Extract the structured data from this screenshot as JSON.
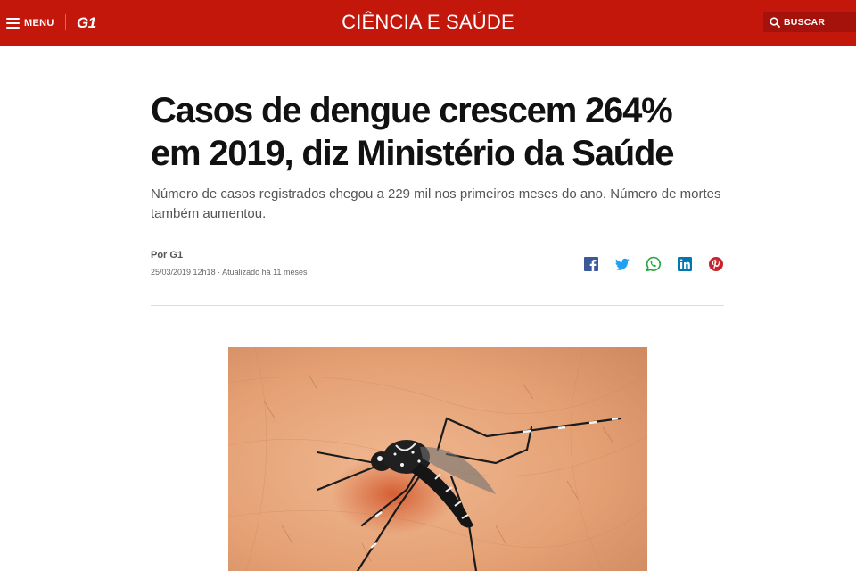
{
  "header": {
    "menu_label": "MENU",
    "logo_text": "G1",
    "section_title": "CIÊNCIA E SAÚDE",
    "search_label": "BUSCAR",
    "colors": {
      "brand_red": "#c4170c",
      "search_bg": "#a4120b"
    }
  },
  "article": {
    "title": "Casos de dengue crescem 264% em 2019, diz Ministério da Saúde",
    "subtitle": "Número de casos registrados chegou a 229 mil nos primeiros meses do ano. Número de mortes também aumentou.",
    "byline": "Por G1",
    "date": "25/03/2019 12h18 · Atualizado há 11 meses"
  },
  "share": {
    "icons": [
      "facebook-icon",
      "twitter-icon",
      "whatsapp-icon",
      "linkedin-icon",
      "pinterest-icon"
    ],
    "colors": {
      "facebook": "#3b5998",
      "twitter": "#1da1f2",
      "whatsapp": "#25a43a",
      "linkedin": "#0077b5",
      "pinterest": "#c8232c"
    }
  },
  "image": {
    "subject": "mosquito-on-skin"
  }
}
